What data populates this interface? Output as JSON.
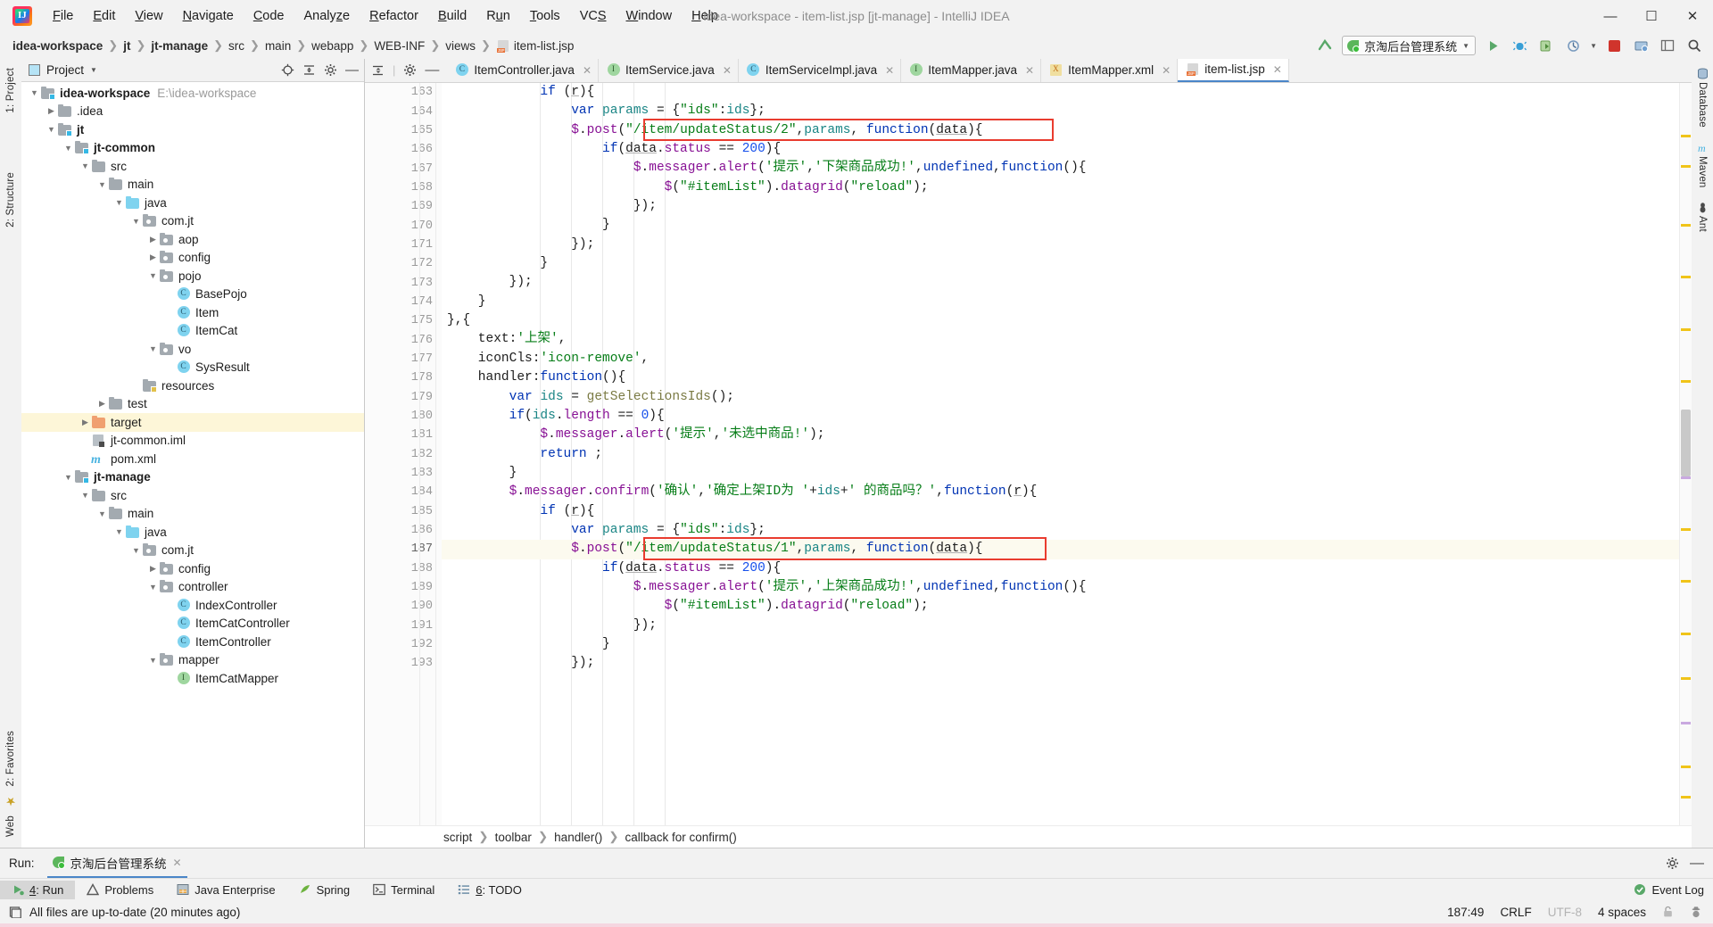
{
  "window": {
    "title": "idea-workspace - item-list.jsp [jt-manage] - IntelliJ IDEA",
    "minimize": "—",
    "maximize": "❐",
    "close": "✕"
  },
  "menu": [
    "File",
    "Edit",
    "View",
    "Navigate",
    "Code",
    "Analyze",
    "Refactor",
    "Build",
    "Run",
    "Tools",
    "VCS",
    "Window",
    "Help"
  ],
  "breadcrumb": [
    "idea-workspace",
    "jt",
    "jt-manage",
    "src",
    "main",
    "webapp",
    "WEB-INF",
    "views",
    "item-list.jsp"
  ],
  "toolbar": {
    "run_config": "京淘后台管理系统",
    "search_icon": "search-icon",
    "hammer_icon": "build-hammer-icon"
  },
  "project_panel": {
    "title": "Project",
    "tree": [
      {
        "depth": 0,
        "arrow": "down",
        "icon": "module-folder",
        "label": "idea-workspace",
        "bold": true,
        "path": "E:\\idea-workspace"
      },
      {
        "depth": 1,
        "arrow": "right",
        "icon": "folder",
        "label": ".idea"
      },
      {
        "depth": 1,
        "arrow": "down",
        "icon": "module-folder",
        "label": "jt",
        "bold": true
      },
      {
        "depth": 2,
        "arrow": "down",
        "icon": "module-folder",
        "label": "jt-common",
        "bold": true
      },
      {
        "depth": 3,
        "arrow": "down",
        "icon": "folder",
        "label": "src"
      },
      {
        "depth": 4,
        "arrow": "down",
        "icon": "folder",
        "label": "main"
      },
      {
        "depth": 5,
        "arrow": "down",
        "icon": "source-folder",
        "label": "java"
      },
      {
        "depth": 6,
        "arrow": "down",
        "icon": "package",
        "label": "com.jt"
      },
      {
        "depth": 7,
        "arrow": "right",
        "icon": "package",
        "label": "aop"
      },
      {
        "depth": 7,
        "arrow": "right",
        "icon": "package",
        "label": "config"
      },
      {
        "depth": 7,
        "arrow": "down",
        "icon": "package",
        "label": "pojo"
      },
      {
        "depth": 8,
        "arrow": "none",
        "icon": "class",
        "label": "BasePojo"
      },
      {
        "depth": 8,
        "arrow": "none",
        "icon": "class",
        "label": "Item"
      },
      {
        "depth": 8,
        "arrow": "none",
        "icon": "class",
        "label": "ItemCat"
      },
      {
        "depth": 7,
        "arrow": "down",
        "icon": "package",
        "label": "vo"
      },
      {
        "depth": 8,
        "arrow": "none",
        "icon": "class",
        "label": "SysResult"
      },
      {
        "depth": 6,
        "arrow": "none",
        "icon": "resource-folder",
        "label": "resources"
      },
      {
        "depth": 4,
        "arrow": "right",
        "icon": "folder",
        "label": "test"
      },
      {
        "depth": 3,
        "arrow": "right",
        "icon": "excluded-folder",
        "label": "target",
        "highlight": true
      },
      {
        "depth": 3,
        "arrow": "none",
        "icon": "iml",
        "label": "jt-common.iml"
      },
      {
        "depth": 3,
        "arrow": "none",
        "icon": "maven",
        "label": "pom.xml"
      },
      {
        "depth": 2,
        "arrow": "down",
        "icon": "module-folder",
        "label": "jt-manage",
        "bold": true
      },
      {
        "depth": 3,
        "arrow": "down",
        "icon": "folder",
        "label": "src"
      },
      {
        "depth": 4,
        "arrow": "down",
        "icon": "folder",
        "label": "main"
      },
      {
        "depth": 5,
        "arrow": "down",
        "icon": "source-folder",
        "label": "java"
      },
      {
        "depth": 6,
        "arrow": "down",
        "icon": "package",
        "label": "com.jt"
      },
      {
        "depth": 7,
        "arrow": "right",
        "icon": "package",
        "label": "config"
      },
      {
        "depth": 7,
        "arrow": "down",
        "icon": "package",
        "label": "controller"
      },
      {
        "depth": 8,
        "arrow": "none",
        "icon": "class",
        "label": "IndexController"
      },
      {
        "depth": 8,
        "arrow": "none",
        "icon": "class",
        "label": "ItemCatController"
      },
      {
        "depth": 8,
        "arrow": "none",
        "icon": "class",
        "label": "ItemController"
      },
      {
        "depth": 7,
        "arrow": "down",
        "icon": "package",
        "label": "mapper"
      },
      {
        "depth": 8,
        "arrow": "none",
        "icon": "interface",
        "label": "ItemCatMapper"
      }
    ]
  },
  "left_rail": [
    "1: Project",
    "2: Structure",
    "2: Favorites",
    "Web"
  ],
  "right_rail": [
    "Database",
    "Maven",
    "Ant"
  ],
  "tabs": [
    {
      "label": "ItemController.java",
      "icon": "class",
      "active": false
    },
    {
      "label": "ItemService.java",
      "icon": "interface",
      "active": false
    },
    {
      "label": "ItemServiceImpl.java",
      "icon": "class",
      "active": false
    },
    {
      "label": "ItemMapper.java",
      "icon": "interface",
      "active": false
    },
    {
      "label": "ItemMapper.xml",
      "icon": "xml",
      "active": false
    },
    {
      "label": "item-list.jsp",
      "icon": "jsp",
      "active": true
    }
  ],
  "editor": {
    "first_line": 163,
    "current_line": 187,
    "lines": [
      {
        "n": 163,
        "fold": "end",
        "text": "            if (r){"
      },
      {
        "n": 164,
        "fold": "none",
        "text": "                var params = {\"ids\":ids};"
      },
      {
        "n": 165,
        "fold": "end",
        "text": "                $.post(\"/item/updateStatus/2\",params, function(data){"
      },
      {
        "n": 166,
        "fold": "end",
        "text": "                    if(data.status == 200){"
      },
      {
        "n": 167,
        "fold": "end",
        "text": "                        $.messager.alert('提示','下架商品成功!',undefined,function(){"
      },
      {
        "n": 168,
        "fold": "none",
        "text": "                            $(\"#itemList\").datagrid(\"reload\");"
      },
      {
        "n": 169,
        "fold": "end",
        "text": "                        });"
      },
      {
        "n": 170,
        "fold": "none",
        "text": "                    }"
      },
      {
        "n": 171,
        "fold": "none",
        "text": "                });"
      },
      {
        "n": 172,
        "fold": "none",
        "text": "            }"
      },
      {
        "n": 173,
        "fold": "none",
        "text": "        });"
      },
      {
        "n": 174,
        "fold": "none",
        "text": "    }"
      },
      {
        "n": 175,
        "fold": "none",
        "text": "},{"
      },
      {
        "n": 176,
        "fold": "none",
        "text": "    text:'上架',"
      },
      {
        "n": 177,
        "fold": "none",
        "text": "    iconCls:'icon-remove',"
      },
      {
        "n": 178,
        "fold": "none",
        "text": "    handler:function(){"
      },
      {
        "n": 179,
        "fold": "none",
        "text": "        var ids = getSelectionsIds();"
      },
      {
        "n": 180,
        "fold": "none",
        "text": "        if(ids.length == 0){"
      },
      {
        "n": 181,
        "fold": "none",
        "text": "            $.messager.alert('提示','未选中商品!');"
      },
      {
        "n": 182,
        "fold": "none",
        "text": "            return ;"
      },
      {
        "n": 183,
        "fold": "none",
        "text": "        }"
      },
      {
        "n": 184,
        "fold": "none",
        "text": "        $.messager.confirm('确认','确定上架ID为 '+ids+' 的商品吗？',function(r){"
      },
      {
        "n": 185,
        "fold": "none",
        "text": "            if (r){"
      },
      {
        "n": 186,
        "fold": "none",
        "text": "                var params = {\"ids\":ids};"
      },
      {
        "n": 187,
        "fold": "none",
        "text": "                $.post(\"/item/updateStatus/1\",params, function(data){"
      },
      {
        "n": 188,
        "fold": "end",
        "text": "                    if(data.status == 200){"
      },
      {
        "n": 189,
        "fold": "end",
        "text": "                        $.messager.alert('提示','上架商品成功!',undefined,function(){"
      },
      {
        "n": 190,
        "fold": "none",
        "text": "                            $(\"#itemList\").datagrid(\"reload\");"
      },
      {
        "n": 191,
        "fold": "none",
        "text": "                        });"
      },
      {
        "n": 192,
        "fold": "none",
        "text": "                    }"
      },
      {
        "n": 193,
        "fold": "none",
        "text": "                });"
      }
    ],
    "highlight_boxes": [
      "line-165-post-updateStatus-2",
      "line-187-post-updateStatus-1"
    ],
    "breadcrumb": [
      "script",
      "toolbar",
      "handler()",
      "callback for confirm()"
    ]
  },
  "run_panel": {
    "label": "Run:",
    "tab": "京淘后台管理系统"
  },
  "tool_windows": [
    {
      "label": "4: Run",
      "underline": "4",
      "icon": "run-icon",
      "selected": true
    },
    {
      "label": "Problems",
      "icon": "warning-icon",
      "selected": false
    },
    {
      "label": "Java Enterprise",
      "icon": "java-ee-icon",
      "selected": false
    },
    {
      "label": "Spring",
      "icon": "spring-leaf-icon",
      "selected": false
    },
    {
      "label": "Terminal",
      "icon": "terminal-icon",
      "selected": false
    },
    {
      "label": "6: TODO",
      "underline": "6",
      "icon": "todo-icon",
      "selected": false
    }
  ],
  "event_log": "Event Log",
  "status_bar": {
    "message": "All files are up-to-date (20 minutes ago)",
    "position": "187:49",
    "line_separator": "CRLF",
    "encoding": "UTF-8",
    "indent": "4 spaces",
    "lock_icon": "lock-icon",
    "hector_icon": "hector-inspection-icon"
  },
  "colors": {
    "accent": "#4a86c8",
    "highlight_box": "#e93c2f",
    "keyword": "#0033b3",
    "string": "#067d17",
    "number": "#1750eb",
    "function": "#7a7a43",
    "variable": "#1a8585",
    "property": "#871094",
    "selected_tree_row": "#fdf6d8"
  }
}
